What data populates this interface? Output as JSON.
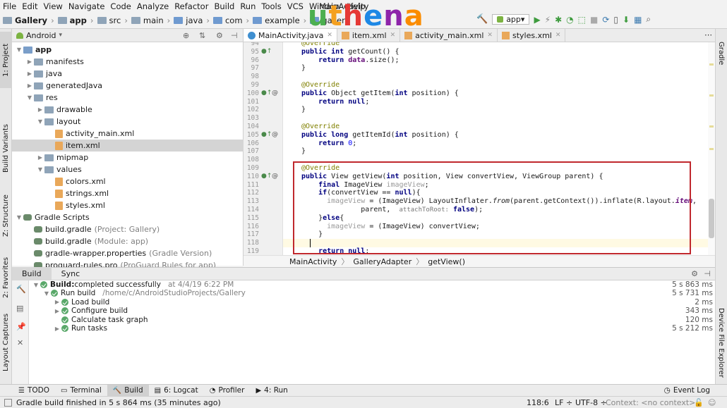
{
  "menu": [
    "File",
    "Edit",
    "View",
    "Navigate",
    "Code",
    "Analyze",
    "Refactor",
    "Build",
    "Run",
    "Tools",
    "VCS",
    "Window",
    "Help"
  ],
  "window_title": "MainActivity",
  "breadcrumb": [
    "Gallery",
    "app",
    "src",
    "main",
    "java",
    "com",
    "example",
    "gallery"
  ],
  "run_config": "app",
  "project_panel": {
    "view_mode": "Android",
    "tree": [
      {
        "label": "app",
        "depth": 0,
        "expanded": true,
        "icon": "folder",
        "bold": true
      },
      {
        "label": "manifests",
        "depth": 1,
        "expanded": false,
        "icon": "folder"
      },
      {
        "label": "java",
        "depth": 1,
        "expanded": false,
        "icon": "folder"
      },
      {
        "label": "generatedJava",
        "depth": 1,
        "expanded": false,
        "icon": "folder"
      },
      {
        "label": "res",
        "depth": 1,
        "expanded": true,
        "icon": "folder"
      },
      {
        "label": "drawable",
        "depth": 2,
        "expanded": false,
        "icon": "folder"
      },
      {
        "label": "layout",
        "depth": 2,
        "expanded": true,
        "icon": "folder"
      },
      {
        "label": "activity_main.xml",
        "depth": 3,
        "icon": "xml-file"
      },
      {
        "label": "item.xml",
        "depth": 3,
        "icon": "xml-file",
        "selected": true
      },
      {
        "label": "mipmap",
        "depth": 2,
        "expanded": false,
        "icon": "folder"
      },
      {
        "label": "values",
        "depth": 2,
        "expanded": true,
        "icon": "folder"
      },
      {
        "label": "colors.xml",
        "depth": 3,
        "icon": "xml-file"
      },
      {
        "label": "strings.xml",
        "depth": 3,
        "icon": "xml-file"
      },
      {
        "label": "styles.xml",
        "depth": 3,
        "icon": "xml-file"
      },
      {
        "label": "Gradle Scripts",
        "depth": 0,
        "expanded": true,
        "icon": "gradle"
      },
      {
        "label": "build.gradle",
        "note": "(Project: Gallery)",
        "depth": 1,
        "icon": "gradle"
      },
      {
        "label": "build.gradle",
        "note": "(Module: app)",
        "depth": 1,
        "icon": "gradle"
      },
      {
        "label": "gradle-wrapper.properties",
        "note": "(Gradle Version)",
        "depth": 1,
        "icon": "gradle"
      },
      {
        "label": "proguard-rules.pro",
        "note": "(ProGuard Rules for app)",
        "depth": 1,
        "icon": "gradle"
      }
    ]
  },
  "editor_tabs": [
    {
      "label": "MainActivity.java",
      "active": true,
      "icon": "class"
    },
    {
      "label": "item.xml",
      "icon": "xml"
    },
    {
      "label": "activity_main.xml",
      "icon": "xml"
    },
    {
      "label": "styles.xml",
      "icon": "xml"
    }
  ],
  "code_lines": [
    {
      "n": "94",
      "html": "<span class='ann'>@Override</span>"
    },
    {
      "n": "95",
      "html": "<span class='kw'>public int</span> getCount() {",
      "mark": true
    },
    {
      "n": "96",
      "html": "    <span class='kw'>return</span> <span class='fld'>data</span>.size();"
    },
    {
      "n": "97",
      "html": "}"
    },
    {
      "n": "98",
      "html": ""
    },
    {
      "n": "99",
      "html": "<span class='ann'>@Override</span>"
    },
    {
      "n": "100",
      "html": "<span class='kw'>public</span> Object getItem(<span class='kw'>int</span> position) {",
      "mark": true,
      "at": true
    },
    {
      "n": "101",
      "html": "    <span class='kw'>return null</span>;"
    },
    {
      "n": "102",
      "html": "}"
    },
    {
      "n": "103",
      "html": ""
    },
    {
      "n": "104",
      "html": "<span class='ann'>@Override</span>"
    },
    {
      "n": "105",
      "html": "<span class='kw'>public long</span> getItemId(<span class='kw'>int</span> position) {",
      "mark": true,
      "at": true
    },
    {
      "n": "106",
      "html": "    <span class='kw'>return</span> <span style='color:#0000ff'>0</span>;"
    },
    {
      "n": "107",
      "html": "}"
    },
    {
      "n": "108",
      "html": ""
    },
    {
      "n": "109",
      "html": "<span class='ann'>@Override</span>"
    },
    {
      "n": "110",
      "html": "<span class='kw'>public</span> View getView(<span class='kw'>int</span> position, View convertView, ViewGroup parent) {",
      "mark": true,
      "at": true
    },
    {
      "n": "111",
      "html": "    <span class='kw'>final</span> ImageView <span class='un'>imageView</span>;"
    },
    {
      "n": "112",
      "html": "    <span class='kw'>if</span>(convertView == <span class='kw'>null</span>){"
    },
    {
      "n": "113",
      "html": "      <span class='un'>imageView</span> = (ImageView) LayoutInflater.<span class='it'>from</span>(parent.getContext()).inflate(R.layout.<span class='fld it'>item</span>,"
    },
    {
      "n": "114",
      "html": "              parent,  <span class='hint'>attachToRoot:</span> <span class='kw'>false</span>);"
    },
    {
      "n": "115",
      "html": "    }<span class='kw'>else</span>{"
    },
    {
      "n": "116",
      "html": "      <span class='un'>imageView</span> = (ImageView) convertView;"
    },
    {
      "n": "117",
      "html": "    }"
    },
    {
      "n": "118",
      "html": "",
      "caret": true
    },
    {
      "n": "119",
      "html": "    <span class='kw'>return null</span>;"
    }
  ],
  "editor_breadcrumb": [
    "MainActivity",
    "GalleryAdapter",
    "getView()"
  ],
  "build_panel": {
    "tabs": [
      "Build",
      "Sync"
    ],
    "rows": [
      {
        "depth": 0,
        "label": "Build:",
        "label2": " completed successfully",
        "note": "at 4/4/19 6:22 PM",
        "time": "5 s 863 ms",
        "expanded": true
      },
      {
        "depth": 1,
        "label": "Run build",
        "note": "/home/c/AndroidStudioProjects/Gallery",
        "time": "5 s 731 ms",
        "expanded": true
      },
      {
        "depth": 2,
        "label": "Load build",
        "time": "2 ms",
        "expanded": false
      },
      {
        "depth": 2,
        "label": "Configure build",
        "time": "343 ms",
        "expanded": false
      },
      {
        "depth": 2,
        "label": "Calculate task graph",
        "time": "120 ms",
        "leaf": true
      },
      {
        "depth": 2,
        "label": "Run tasks",
        "time": "5 s 212 ms",
        "expanded": false
      }
    ]
  },
  "left_tabs": [
    "1: Project",
    "Build Variants",
    "Z: Structure",
    "2: Favorites",
    "Layout Captures"
  ],
  "right_tabs": [
    "Gradle",
    "Device File Explorer"
  ],
  "tool_windows": [
    {
      "label": "TODO"
    },
    {
      "label": "Terminal"
    },
    {
      "label": "Build",
      "active": true
    },
    {
      "label": "6: Logcat"
    },
    {
      "label": "Profiler"
    },
    {
      "label": "4: Run"
    }
  ],
  "event_log": "Event Log",
  "status": {
    "message": "Gradle build finished in 5 s 864 ms (35 minutes ago)",
    "position": "118:6",
    "line_sep": "LF",
    "encoding": "UTF-8",
    "context": "Context: <no context>"
  },
  "watermark": "uhena",
  "colors": {
    "highlight_box": "#c0282d",
    "success": "#59a869"
  }
}
